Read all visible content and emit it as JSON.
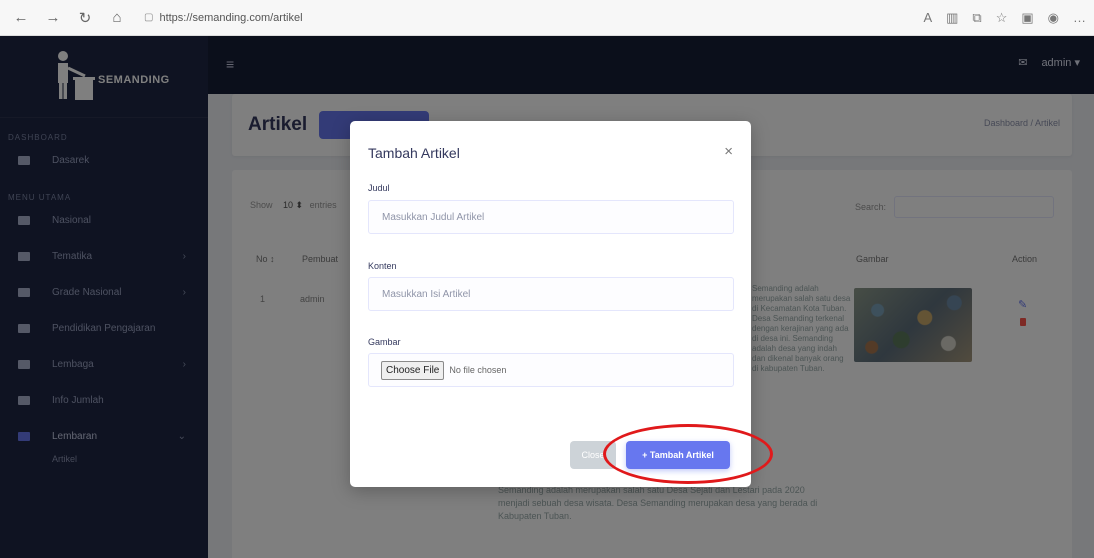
{
  "browser": {
    "url": "https://semanding.com/artikel"
  },
  "brand": {
    "name": "SEMANDING"
  },
  "navbar": {
    "user": "admin",
    "caret": "▾"
  },
  "sidebar": {
    "header1": "DASHBOARD",
    "header2": "MENU UTAMA",
    "items": [
      {
        "label": "Dasarek",
        "chevron": ""
      },
      {
        "label": "Nasional",
        "chevron": ""
      },
      {
        "label": "Tematika",
        "chevron": "›"
      },
      {
        "label": "Grade Nasional",
        "chevron": "›"
      },
      {
        "label": "Pendidikan Pengajaran",
        "chevron": ""
      },
      {
        "label": "Lembaga",
        "chevron": "›"
      },
      {
        "label": "Info Jumlah",
        "chevron": ""
      },
      {
        "label": "Lembaran",
        "chevron": "⌄"
      }
    ],
    "sub_item": "Artikel"
  },
  "page": {
    "title": "Artikel",
    "breadcrumb": "Dashboard / Artikel"
  },
  "table": {
    "show_label": "Show",
    "show_value": "10 ⬍",
    "entries_label": "entries",
    "search_label": "Search:",
    "headers": {
      "no": "No ↕",
      "title": "Pembuat",
      "image": "Gambar",
      "action": "Action"
    },
    "row1": {
      "no": "1",
      "title": "admin"
    },
    "description_side": "Semanding adalah merupakan salah satu desa di Kecamatan Kota Tuban. Desa Semanding terkenal dengan kerajinan yang ada di desa ini. Semanding adalah desa yang indah dan dikenal banyak orang di kabupaten Tuban.",
    "description_bottom": "Semanding adalah merupakan salah satu Desa Sejati dan Lestari pada 2020 menjadi sebuah desa wisata. Desa Semanding merupakan desa yang berada di Kabupaten Tuban."
  },
  "modal": {
    "title": "Tambah Artikel",
    "close_icon": "×",
    "fields": {
      "judul_label": "Judul",
      "judul_placeholder": "Masukkan Judul Artikel",
      "konten_label": "Konten",
      "konten_placeholder": "Masukkan Isi Artikel",
      "gambar_label": "Gambar",
      "file_button": "Choose File",
      "file_status": "No file chosen"
    },
    "buttons": {
      "close": "Close",
      "submit": "+ Tambah Artikel"
    }
  },
  "colors": {
    "primary": "#6777ef",
    "sidebar": "#1f2744",
    "highlight": "#e0191b"
  }
}
